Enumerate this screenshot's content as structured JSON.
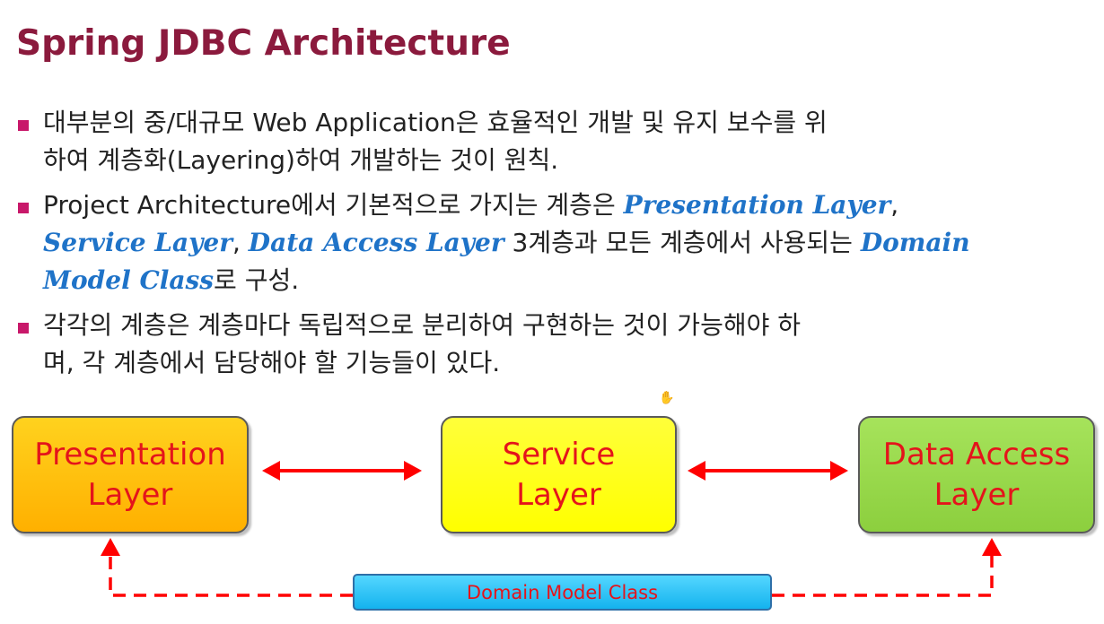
{
  "title": "Spring JDBC Architecture",
  "bullets": [
    {
      "line1": "대부분의 중/대규모 Web Application은 효율적인 개발 및 유지 보수를 위",
      "line2": "하여 계층화(Layering)하여 개발하는 것이 원칙."
    },
    {
      "part1": "Project Architecture에서 기본적으로 가지는 계층은 ",
      "em1": "Presentation Layer",
      "part2": ",",
      "em2": "Service Layer",
      "part3": ", ",
      "em3": "Data Access Layer",
      "part4": " 3계층과 모든 계층에서 사용되는 ",
      "em4a": "Domain",
      "em4b": "Model Class",
      "part5": "로 구성."
    },
    {
      "line1": "각각의 계층은 계층마다 독립적으로 분리하여 구현하는 것이 가능해야 하",
      "line2": "며, 각 계층에서 담당해야 할 기능들이 있다."
    }
  ],
  "diagram": {
    "presentation": {
      "line1": "Presentation",
      "line2": "Layer"
    },
    "service": {
      "line1": "Service",
      "line2": "Layer"
    },
    "data_access": {
      "line1": "Data Access",
      "line2": "Layer"
    },
    "domain": "Domain Model Class"
  },
  "colors": {
    "title": "#8b1a3d",
    "bullet_marker": "#c8186a",
    "emphasis": "#1f73c8",
    "arrow": "#ff0000",
    "layer_text": "#e4141b"
  }
}
